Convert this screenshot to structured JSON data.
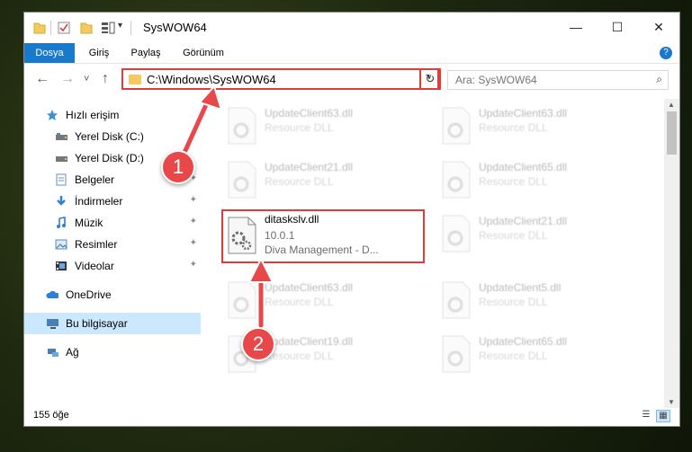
{
  "window": {
    "title": "SysWOW64",
    "min_glyph": "—",
    "max_glyph": "☐",
    "close_glyph": "✕"
  },
  "quick_access_toolbar": {
    "dropdown_glyph": "▾"
  },
  "ribbon": {
    "tabs": [
      "Dosya",
      "Giriş",
      "Paylaş",
      "Görünüm"
    ],
    "help_glyph": "?"
  },
  "navigation": {
    "back_glyph": "←",
    "forward_glyph": "→",
    "recent_glyph": "˅",
    "up_glyph": "↑",
    "address_path": "C:\\Windows\\SysWOW64",
    "address_dropdown_glyph": "˅",
    "refresh_glyph": "↻",
    "search_placeholder": "Ara: SysWOW64",
    "search_glyph": "⌕"
  },
  "sidebar": {
    "items": [
      {
        "label": "Hızlı erişim",
        "icon": "star-icon",
        "pinned": false
      },
      {
        "label": "Yerel Disk (C:)",
        "icon": "drive-icon",
        "pinned": false
      },
      {
        "label": "Yerel Disk (D:)",
        "icon": "drive-icon",
        "pinned": false
      },
      {
        "label": "Belgeler",
        "icon": "documents-icon",
        "pinned": true
      },
      {
        "label": "İndirmeler",
        "icon": "download-icon",
        "pinned": true
      },
      {
        "label": "Müzik",
        "icon": "music-icon",
        "pinned": true
      },
      {
        "label": "Resimler",
        "icon": "pictures-icon",
        "pinned": true
      },
      {
        "label": "Videolar",
        "icon": "videos-icon",
        "pinned": true
      },
      {
        "label": "OneDrive",
        "icon": "cloud-icon",
        "pinned": false
      },
      {
        "label": "Bu bilgisayar",
        "icon": "computer-icon",
        "pinned": false
      },
      {
        "label": "Ağ",
        "icon": "network-icon",
        "pinned": false
      }
    ],
    "pin_glyph": "📌"
  },
  "files": {
    "left": [
      {
        "name": "UpdateClient63.dll",
        "type": "Resource DLL"
      },
      {
        "name": "UpdateClient21.dll",
        "type": "Resource DLL"
      },
      {
        "name": "ditaskslv.dll",
        "version": "10.0.1",
        "desc": "Diva Management - D..."
      },
      {
        "name": "UpdateClient63.dll",
        "type": "Resource DLL"
      },
      {
        "name": "UpdateClient19.dll",
        "type": "Resource DLL"
      }
    ],
    "right": [
      {
        "name": "UpdateClient63.dll",
        "type": "Resource DLL"
      },
      {
        "name": "UpdateClient65.dll",
        "type": "Resource DLL"
      },
      {
        "name": "UpdateClient21.dll",
        "type": "Resource DLL"
      },
      {
        "name": "UpdateClient5.dll",
        "type": "Resource DLL"
      },
      {
        "name": "UpdateClient65.dll",
        "type": "Resource DLL"
      }
    ]
  },
  "status": {
    "item_count": "155 öğe"
  },
  "callouts": [
    "1",
    "2"
  ],
  "colors": {
    "accent": "#1979ca",
    "highlight": "#e03c3c",
    "callout": "#e8484a",
    "selected": "#cce8ff"
  }
}
